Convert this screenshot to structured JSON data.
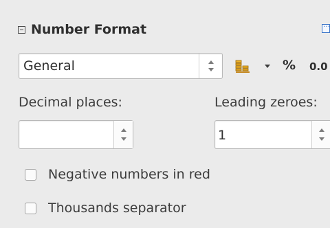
{
  "panel": {
    "title": "Number Format",
    "collapse_icon": "collapse-minus-icon",
    "more_icon": "more-options-icon"
  },
  "format": {
    "category": "General",
    "currency_icon": "currency-coins-icon",
    "currency_dropdown_icon": "dropdown-arrow-icon",
    "percent_label": "%",
    "decimal_label": "0.0"
  },
  "decimal_places": {
    "label": "Decimal places:",
    "value": ""
  },
  "leading_zeroes": {
    "label": "Leading zeroes:",
    "value": "1"
  },
  "options": {
    "negative_red": {
      "label": "Negative numbers in red",
      "checked": false
    },
    "thousands_separator": {
      "label": "Thousands separator",
      "checked": false
    }
  }
}
